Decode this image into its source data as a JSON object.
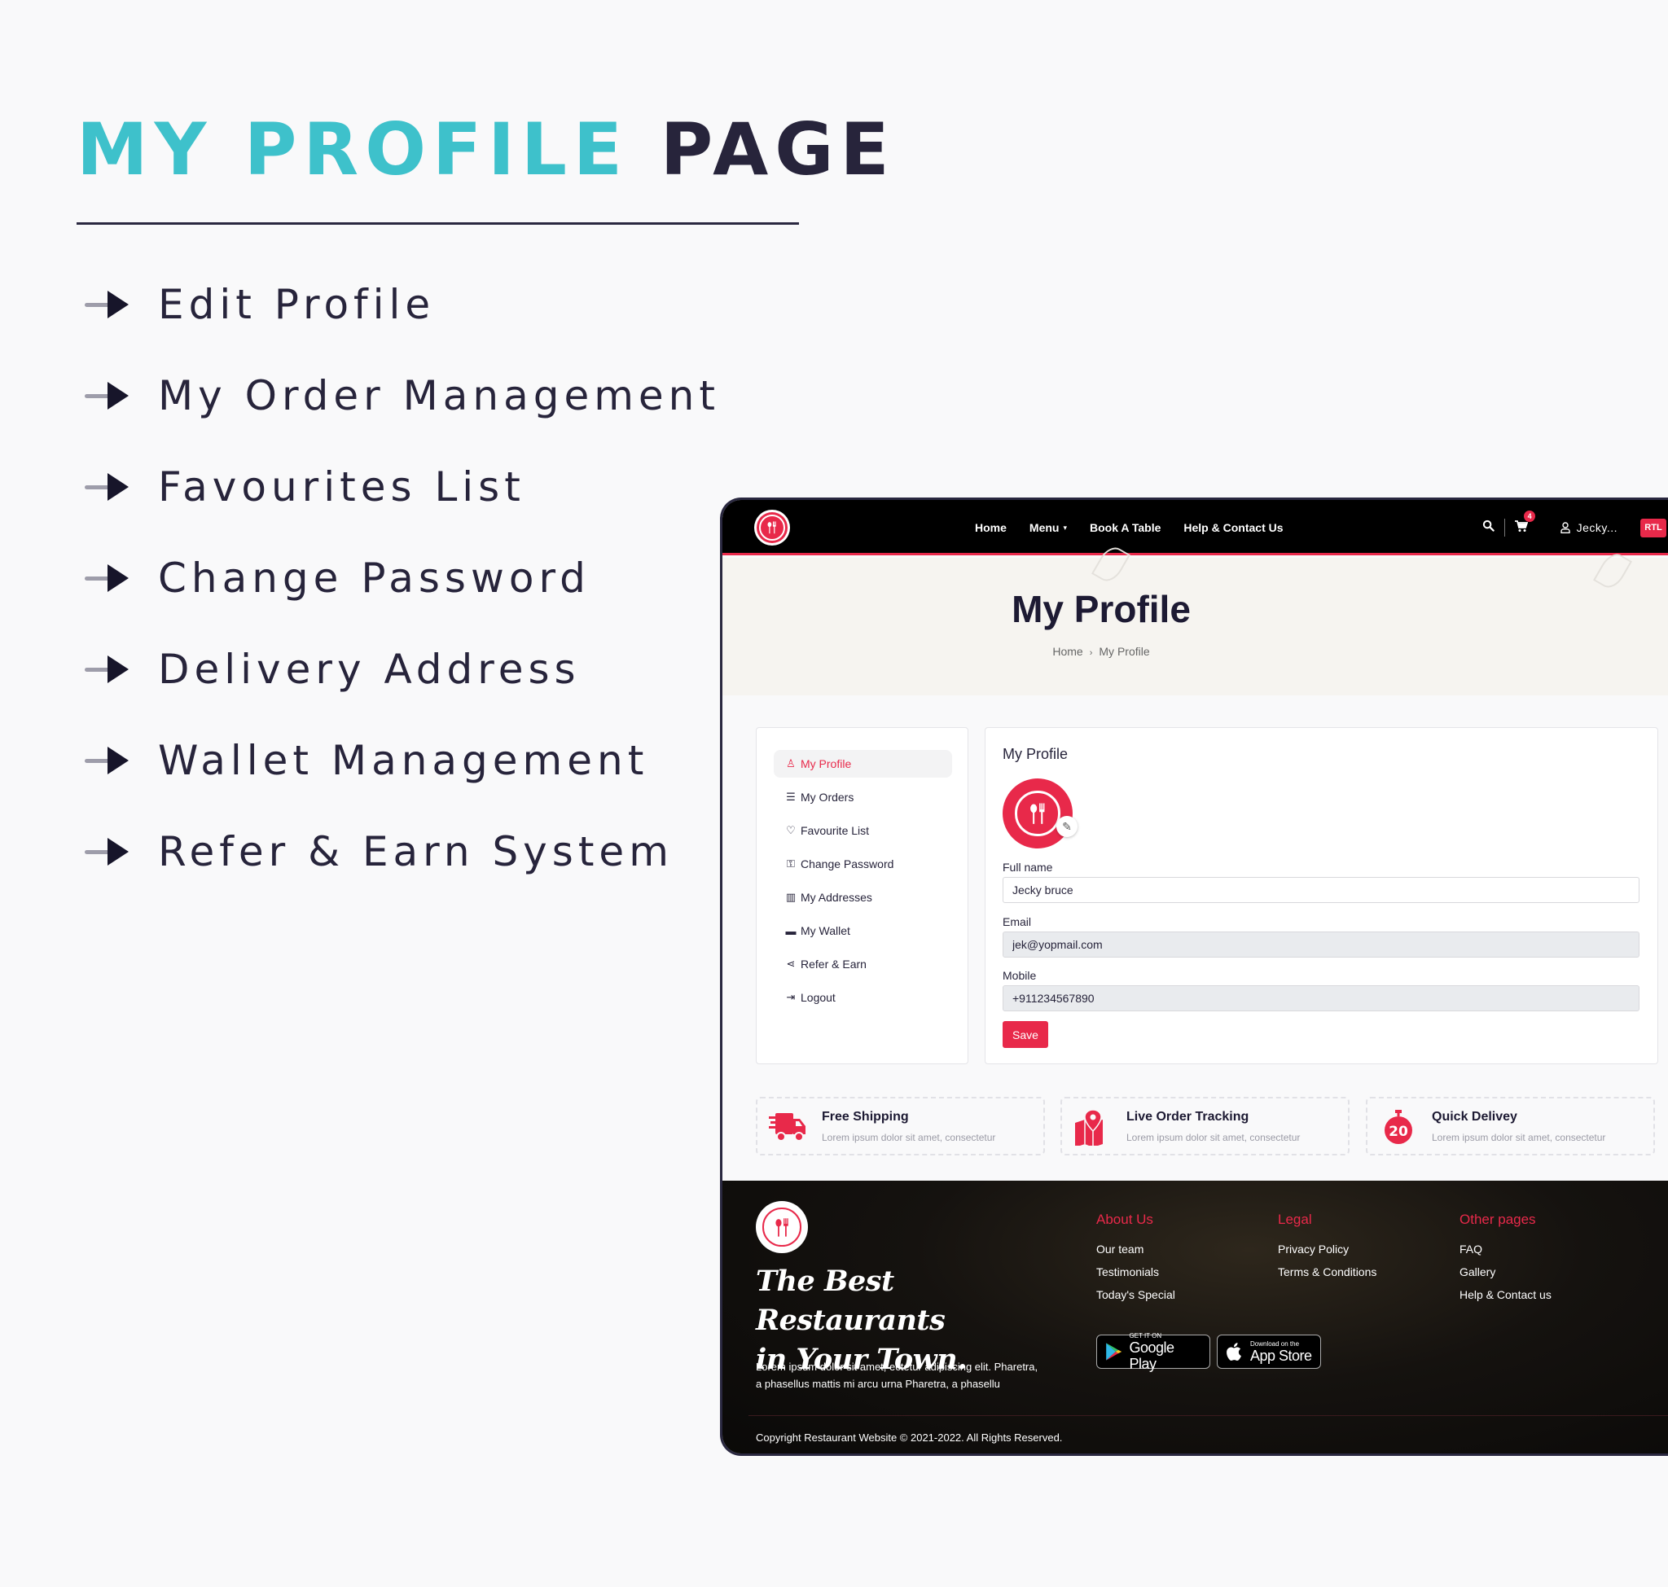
{
  "promo": {
    "title_accent": "MY PROFILE",
    "title_dark": "PAGE",
    "features": [
      "Edit Profile",
      "My Order Management",
      "Favourites List",
      "Change Password",
      "Delivery Address",
      "Wallet Management",
      "Refer & Earn System"
    ]
  },
  "colors": {
    "accent": "#e8294a",
    "teal": "#3ec1cb",
    "navy": "#27243b"
  },
  "nav": {
    "links": [
      "Home",
      "Menu",
      "Book A Table",
      "Help & Contact Us"
    ],
    "menu_caret": "▾",
    "cart_count": "4",
    "user_label": "Jecky...",
    "rtl_label": "RTL",
    "icons": {
      "search": "search-icon",
      "cart": "cart-icon",
      "user": "user-icon"
    }
  },
  "hero": {
    "title": "My Profile",
    "breadcrumb": [
      "Home",
      "My Profile"
    ],
    "breadcrumb_sep": "›"
  },
  "sidebar": {
    "items": [
      {
        "label": "My Profile",
        "icon": "user-icon",
        "glyph": "♙",
        "active": true
      },
      {
        "label": "My Orders",
        "icon": "list-check-icon",
        "glyph": "☰",
        "active": false
      },
      {
        "label": "Favourite List",
        "icon": "heart-icon",
        "glyph": "♡",
        "active": false
      },
      {
        "label": "Change Password",
        "icon": "key-icon",
        "glyph": "⚿",
        "active": false
      },
      {
        "label": "My Addresses",
        "icon": "map-icon",
        "glyph": "▥",
        "active": false
      },
      {
        "label": "My Wallet",
        "icon": "wallet-icon",
        "glyph": "▬",
        "active": false
      },
      {
        "label": "Refer & Earn",
        "icon": "share-icon",
        "glyph": "⋖",
        "active": false
      },
      {
        "label": "Logout",
        "icon": "logout-icon",
        "glyph": "⇥",
        "active": false
      }
    ]
  },
  "profile": {
    "card_title": "My Profile",
    "edit_glyph": "✎",
    "fields": {
      "full_name": {
        "label": "Full name",
        "value": "Jecky bruce"
      },
      "email": {
        "label": "Email",
        "value": "jek@yopmail.com"
      },
      "mobile": {
        "label": "Mobile",
        "value": "+911234567890"
      }
    },
    "save_label": "Save"
  },
  "features": [
    {
      "title": "Free Shipping",
      "desc": "Lorem ipsum dolor sit amet, consectetur",
      "icon": "truck-icon"
    },
    {
      "title": "Live Order Tracking",
      "desc": "Lorem ipsum dolor sit amet, consectetur",
      "icon": "map-pin-icon"
    },
    {
      "title": "Quick Delivey",
      "desc": "Lorem ipsum dolor sit amet, consectetur",
      "icon": "stopwatch-icon",
      "badge": "20"
    }
  ],
  "footer": {
    "tagline_line1": "The Best Restaurants",
    "tagline_line2": "in Your Town.",
    "description": "Lorem ipsum dolor sit amet, ectetur adipiscing elit. Pharetra, a phasellus mattis mi arcu urna Pharetra, a phasellu",
    "columns": [
      {
        "heading": "About Us",
        "links": [
          "Our team",
          "Testimonials",
          "Today's Special"
        ]
      },
      {
        "heading": "Legal",
        "links": [
          "Privacy Policy",
          "Terms & Conditions"
        ]
      },
      {
        "heading": "Other pages",
        "links": [
          "FAQ",
          "Gallery",
          "Help & Contact us"
        ]
      }
    ],
    "google_play": {
      "small": "GET IT ON",
      "big": "Google Play"
    },
    "app_store": {
      "small": "Download on the",
      "big": "App Store"
    },
    "copyright": "Copyright Restaurant Website © 2021-2022. All Rights Reserved."
  }
}
